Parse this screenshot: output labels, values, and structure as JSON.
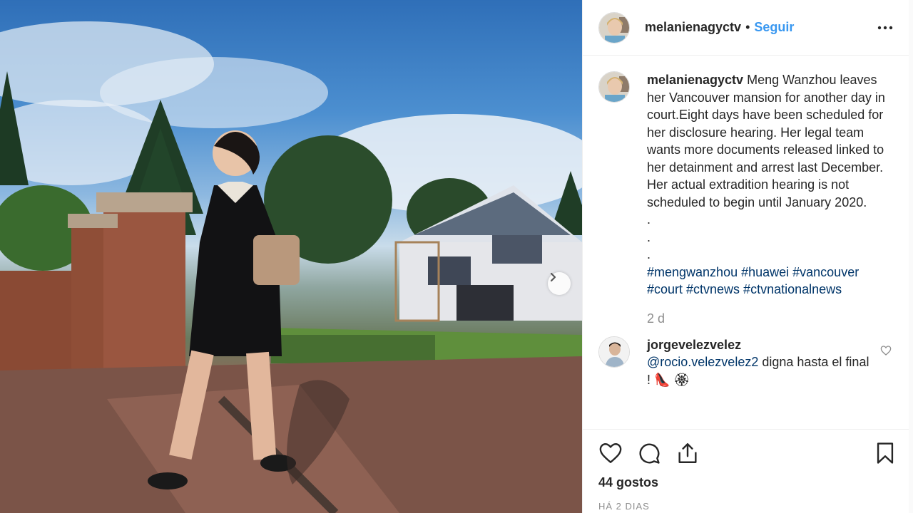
{
  "post": {
    "username": "melanienagyctv",
    "follow_separator": "•",
    "follow_label": "Seguir",
    "caption": {
      "username": "melanienagyctv",
      "text": "Meng Wanzhou leaves her Vancouver mansion for another day in court.Eight days have been scheduled for her disclosure hearing. Her legal team wants more documents released linked to her detainment and arrest last December. Her actual extradition hearing is not scheduled to begin until January 2020.",
      "dots": [
        ".",
        ".",
        "."
      ],
      "hashtags": "#mengwanzhou #huawei #vancouver #court #ctvnews #ctvnationalnews",
      "age": "2 d"
    },
    "comments": [
      {
        "username": "jorgevelezvelez",
        "mention": "@rocio.velezvelez2",
        "text": " digna hasta el final ! 👠 🏵"
      }
    ],
    "likes_label": "44 gostos",
    "posted_label": "HÁ 2 DIAS"
  },
  "icons": {
    "more": "more-options-icon",
    "next": "chevron-right-icon",
    "like": "heart-icon",
    "comment": "comment-bubble-icon",
    "share": "share-icon",
    "save": "bookmark-icon"
  },
  "colors": {
    "link": "#3897f0",
    "hashtag": "#003569",
    "muted": "#8e8e8e",
    "border": "#efefef"
  }
}
